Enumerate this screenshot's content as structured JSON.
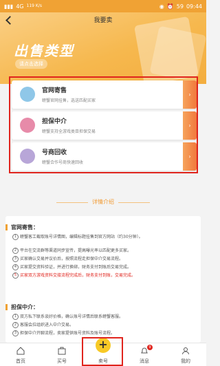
{
  "status": {
    "time": "09:44",
    "carrier": "4G",
    "net": "119\nK/s",
    "battery": "59"
  },
  "nav": {
    "title": "我要卖"
  },
  "hero": {
    "title": "出售类型",
    "tag": "请点击选择"
  },
  "options": [
    {
      "name": "官网寄售",
      "desc": "螃蟹官网挂售，选送匹配买家",
      "color": "#8fc7e8"
    },
    {
      "name": "担保中介",
      "desc": "螃蟹支持全游戏类目担保交易",
      "color": "#e78ba9"
    },
    {
      "name": "号商回收",
      "desc": "螃蟹合作号商快速回收",
      "color": "#b8a6d8"
    }
  ],
  "detail": {
    "heading": "详情介绍",
    "sections": [
      {
        "title": "官网寄售：",
        "steps": [
          {
            "num": "1",
            "text": "螃蟹客工截取账号详情图，编辑标题挂售到官方网站（约30分钟）。",
            "red": false
          },
          {
            "num": "2",
            "text": "平台在交流群等渠道同步宣传，提高曝光率以匹配更多买家。",
            "red": false
          },
          {
            "num": "3",
            "text": "买家确认交易并议价后，按照流程走担保中介交易流程。",
            "red": false
          },
          {
            "num": "4",
            "text": "买家提交资料验证，并进行换绑，财务支付到账后交易完成。",
            "red": false
          },
          {
            "num": "5",
            "text": "买家双方游戏资料交接流程完成后，财务支付到账，交易完成。",
            "red": true
          }
        ]
      },
      {
        "title": "担保中介：",
        "steps": [
          {
            "num": "1",
            "text": "双方私下联系谈好价格，确认账号详情后联系螃蟹客服。",
            "red": false
          },
          {
            "num": "2",
            "text": "客服会拉组织进入中介交易。",
            "red": false
          },
          {
            "num": "3",
            "text": "担保中介开聊流程，卖家提供账号资料及账号流程。",
            "red": false
          }
        ]
      }
    ]
  },
  "tabs": [
    {
      "label": "首页",
      "icon": "home-icon"
    },
    {
      "label": "买号",
      "icon": "buy-icon"
    },
    {
      "label": "卖号",
      "icon": "plus-icon"
    },
    {
      "label": "消息",
      "icon": "bell-icon",
      "badge": "9"
    },
    {
      "label": "我的",
      "icon": "user-icon"
    }
  ]
}
